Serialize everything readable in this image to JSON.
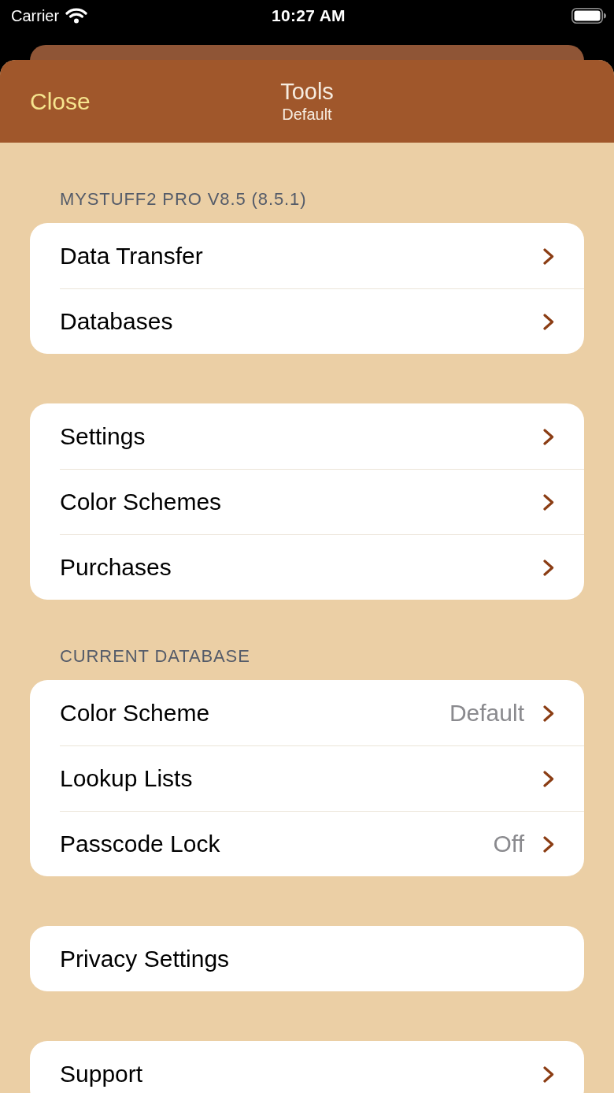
{
  "status_bar": {
    "carrier": "Carrier",
    "time": "10:27 AM"
  },
  "nav_bar": {
    "close": "Close",
    "title": "Tools",
    "subtitle": "Default"
  },
  "sections": [
    {
      "header": "MYSTUFF2 PRO V8.5 (8.5.1)",
      "rows": [
        {
          "label": "Data Transfer",
          "disclosure": true
        },
        {
          "label": "Databases",
          "disclosure": true
        }
      ]
    },
    {
      "rows": [
        {
          "label": "Settings",
          "disclosure": true
        },
        {
          "label": "Color Schemes",
          "disclosure": true
        },
        {
          "label": "Purchases",
          "disclosure": true
        }
      ]
    },
    {
      "header": "CURRENT DATABASE",
      "rows": [
        {
          "label": "Color Scheme",
          "value": "Default",
          "disclosure": true
        },
        {
          "label": "Lookup Lists",
          "disclosure": true
        },
        {
          "label": "Passcode Lock",
          "value": "Off",
          "disclosure": true
        }
      ]
    },
    {
      "rows": [
        {
          "label": "Privacy Settings",
          "disclosure": false
        }
      ]
    },
    {
      "rows": [
        {
          "label": "Support",
          "disclosure": true
        }
      ]
    }
  ]
}
